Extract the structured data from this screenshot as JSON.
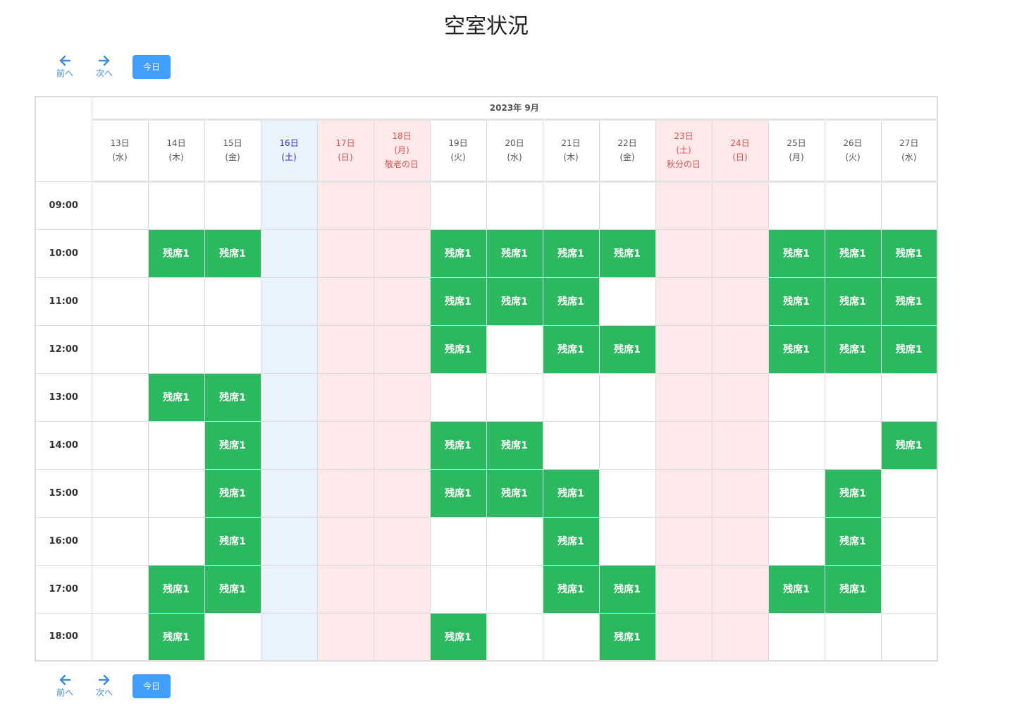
{
  "page": {
    "title": "空室状況"
  },
  "nav": {
    "prev_label": "前へ",
    "next_label": "次へ",
    "today_label": "今日"
  },
  "calendar": {
    "month_label": "2023年 9月",
    "days": [
      {
        "date": "13日",
        "weekday": "(水)",
        "holiday": "",
        "type": "weekday"
      },
      {
        "date": "14日",
        "weekday": "(木)",
        "holiday": "",
        "type": "weekday"
      },
      {
        "date": "15日",
        "weekday": "(金)",
        "holiday": "",
        "type": "weekday"
      },
      {
        "date": "16日",
        "weekday": "(土)",
        "holiday": "",
        "type": "saturday"
      },
      {
        "date": "17日",
        "weekday": "(日)",
        "holiday": "",
        "type": "holiday"
      },
      {
        "date": "18日",
        "weekday": "(月)",
        "holiday": "敬老の日",
        "type": "holiday"
      },
      {
        "date": "19日",
        "weekday": "(火)",
        "holiday": "",
        "type": "weekday"
      },
      {
        "date": "20日",
        "weekday": "(水)",
        "holiday": "",
        "type": "weekday"
      },
      {
        "date": "21日",
        "weekday": "(木)",
        "holiday": "",
        "type": "weekday"
      },
      {
        "date": "22日",
        "weekday": "(金)",
        "holiday": "",
        "type": "weekday"
      },
      {
        "date": "23日",
        "weekday": "(土)",
        "holiday": "秋分の日",
        "type": "holiday"
      },
      {
        "date": "24日",
        "weekday": "(日)",
        "holiday": "",
        "type": "holiday"
      },
      {
        "date": "25日",
        "weekday": "(月)",
        "holiday": "",
        "type": "weekday"
      },
      {
        "date": "26日",
        "weekday": "(火)",
        "holiday": "",
        "type": "weekday"
      },
      {
        "date": "27日",
        "weekday": "(水)",
        "holiday": "",
        "type": "weekday"
      }
    ],
    "slot_label": "残席1",
    "rows": [
      {
        "time": "09:00",
        "available": [
          0,
          0,
          0,
          0,
          0,
          0,
          0,
          0,
          0,
          0,
          0,
          0,
          0,
          0,
          0
        ]
      },
      {
        "time": "10:00",
        "available": [
          0,
          1,
          1,
          0,
          0,
          0,
          1,
          1,
          1,
          1,
          0,
          0,
          1,
          1,
          1
        ]
      },
      {
        "time": "11:00",
        "available": [
          0,
          0,
          0,
          0,
          0,
          0,
          1,
          1,
          1,
          0,
          0,
          0,
          1,
          1,
          1
        ]
      },
      {
        "time": "12:00",
        "available": [
          0,
          0,
          0,
          0,
          0,
          0,
          1,
          0,
          1,
          1,
          0,
          0,
          1,
          1,
          1
        ]
      },
      {
        "time": "13:00",
        "available": [
          0,
          1,
          1,
          0,
          0,
          0,
          0,
          0,
          0,
          0,
          0,
          0,
          0,
          0,
          0
        ]
      },
      {
        "time": "14:00",
        "available": [
          0,
          0,
          1,
          0,
          0,
          0,
          1,
          1,
          0,
          0,
          0,
          0,
          0,
          0,
          1
        ]
      },
      {
        "time": "15:00",
        "available": [
          0,
          0,
          1,
          0,
          0,
          0,
          1,
          1,
          1,
          0,
          0,
          0,
          0,
          1,
          0
        ]
      },
      {
        "time": "16:00",
        "available": [
          0,
          0,
          1,
          0,
          0,
          0,
          0,
          0,
          1,
          0,
          0,
          0,
          0,
          1,
          0
        ]
      },
      {
        "time": "17:00",
        "available": [
          0,
          1,
          1,
          0,
          0,
          0,
          0,
          0,
          1,
          1,
          0,
          0,
          1,
          1,
          0
        ]
      },
      {
        "time": "18:00",
        "available": [
          0,
          1,
          0,
          0,
          0,
          0,
          1,
          0,
          0,
          1,
          0,
          0,
          0,
          0,
          0
        ]
      }
    ]
  },
  "colors": {
    "available": "#2bb85f",
    "saturday_bg": "#e8f3fd",
    "holiday_bg": "#fde9e9",
    "holiday_text": "#e0504f",
    "saturday_text": "#2b2bd6",
    "accent": "#409eff"
  }
}
